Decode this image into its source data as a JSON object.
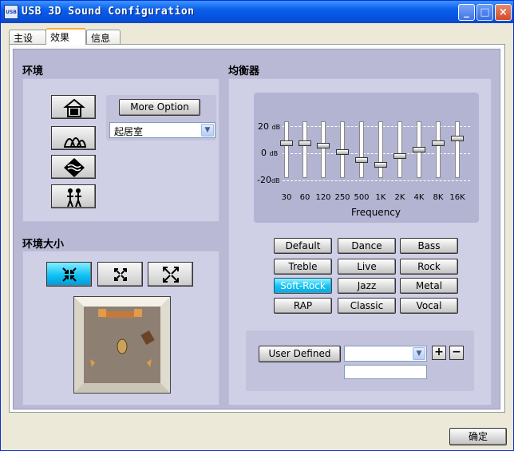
{
  "window": {
    "title": "USB 3D Sound Configuration",
    "icon_label": "USB"
  },
  "tabs": [
    {
      "label": "主设置"
    },
    {
      "label": "效果"
    },
    {
      "label": "信息"
    }
  ],
  "environment": {
    "title": "环境",
    "more_option_label": "More Option",
    "preset_selected": "起居室",
    "icons": [
      "theater-icon",
      "opera-house-icon",
      "underwater-icon",
      "outdoor-people-icon"
    ]
  },
  "env_size": {
    "title": "环境大小",
    "selected_index": 0
  },
  "equalizer": {
    "title": "均衡器",
    "db_labels": {
      "top": "20",
      "mid": "0",
      "bottom": "-20",
      "unit": "dB"
    },
    "frequency_label": "Frequency",
    "bands": [
      {
        "label": "30",
        "level_db": 5
      },
      {
        "label": "60",
        "level_db": 5
      },
      {
        "label": "120",
        "level_db": 3
      },
      {
        "label": "250",
        "level_db": -2
      },
      {
        "label": "500",
        "level_db": -8
      },
      {
        "label": "1K",
        "level_db": -12
      },
      {
        "label": "2K",
        "level_db": -5
      },
      {
        "label": "4K",
        "level_db": 0
      },
      {
        "label": "8K",
        "level_db": 5
      },
      {
        "label": "16K",
        "level_db": 9
      }
    ],
    "presets": [
      [
        "Default",
        "Dance",
        "Bass"
      ],
      [
        "Treble",
        "Live",
        "Rock"
      ],
      [
        "Soft-Rock",
        "Jazz",
        "Metal"
      ],
      [
        "RAP",
        "Classic",
        "Vocal"
      ]
    ],
    "selected_preset": "Soft-Rock",
    "user_defined_label": "User  Defined",
    "user_select_value": "",
    "user_name_value": "",
    "plus_label": "+",
    "minus_label": "−"
  },
  "footer": {
    "ok_label": "确定"
  },
  "colors": {
    "titlebar": "#0554e3",
    "selected_button": "#17c5f4",
    "panel": "#cfcfe5"
  }
}
